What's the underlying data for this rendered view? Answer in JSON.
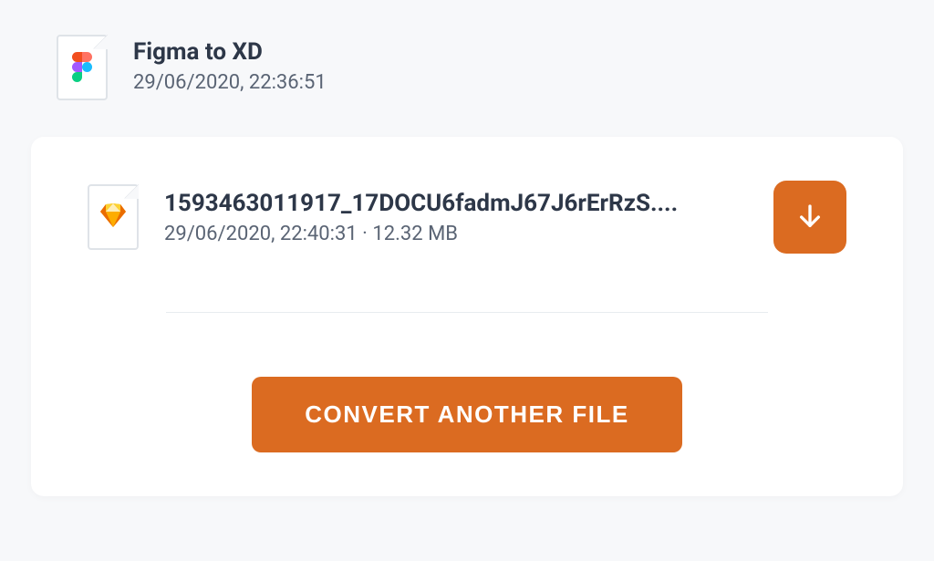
{
  "header": {
    "title": "Figma to XD",
    "date": "29/06/2020, 22:36:51"
  },
  "result": {
    "filename": "1593463011917_17DOCU6fadmJ67J6rErRzS....",
    "date": "29/06/2020, 22:40:31",
    "size": "12.32 MB"
  },
  "actions": {
    "convert_label": "CONVERT ANOTHER FILE"
  }
}
